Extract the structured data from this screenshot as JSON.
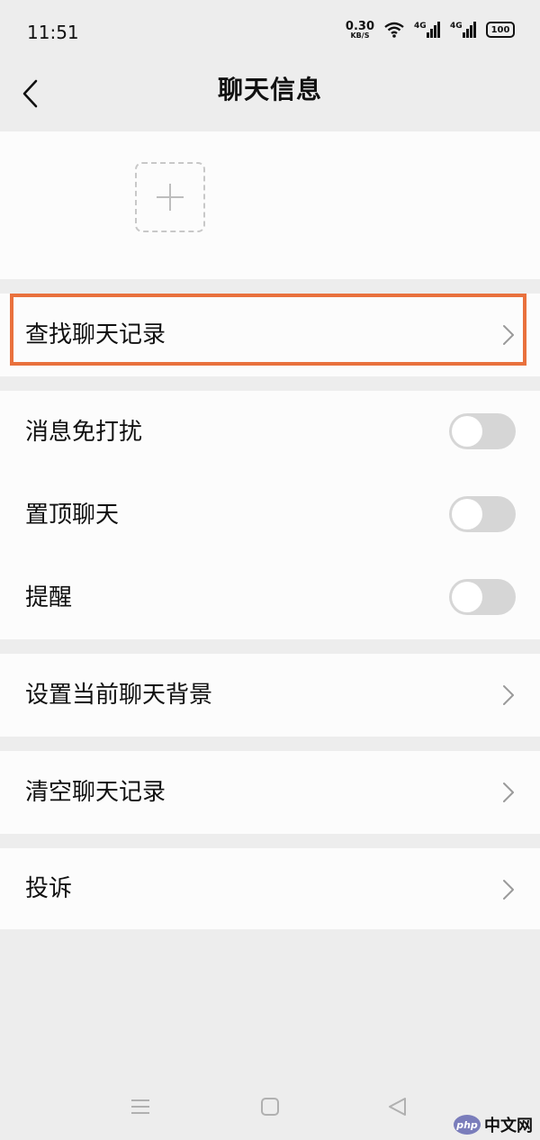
{
  "status_bar": {
    "time": "11:51",
    "net_speed_value": "0.30",
    "net_speed_unit": "KB/S",
    "sim1_label": "4G",
    "sim2_label": "4G",
    "battery": "100"
  },
  "header": {
    "title": "聊天信息"
  },
  "rows": {
    "search_history": "查找聊天记录",
    "mute_notifications": "消息免打扰",
    "pin_chat": "置顶聊天",
    "reminder": "提醒",
    "set_background": "设置当前聊天背景",
    "clear_history": "清空聊天记录",
    "report": "投诉"
  },
  "toggles": {
    "mute_notifications": false,
    "pin_chat": false,
    "reminder": false
  },
  "watermark": {
    "logo": "php",
    "text": "中文网"
  },
  "colors": {
    "background": "#ededed",
    "section": "#fcfcfc",
    "highlight": "#e9713d",
    "toggle_off": "#d6d6d6"
  },
  "icons": {
    "back": "chevron-left-icon",
    "add_member": "plus-icon",
    "row_arrow": "chevron-right-icon",
    "nav_menu": "menu-icon",
    "nav_home": "square-icon",
    "nav_back": "triangle-left-icon"
  }
}
